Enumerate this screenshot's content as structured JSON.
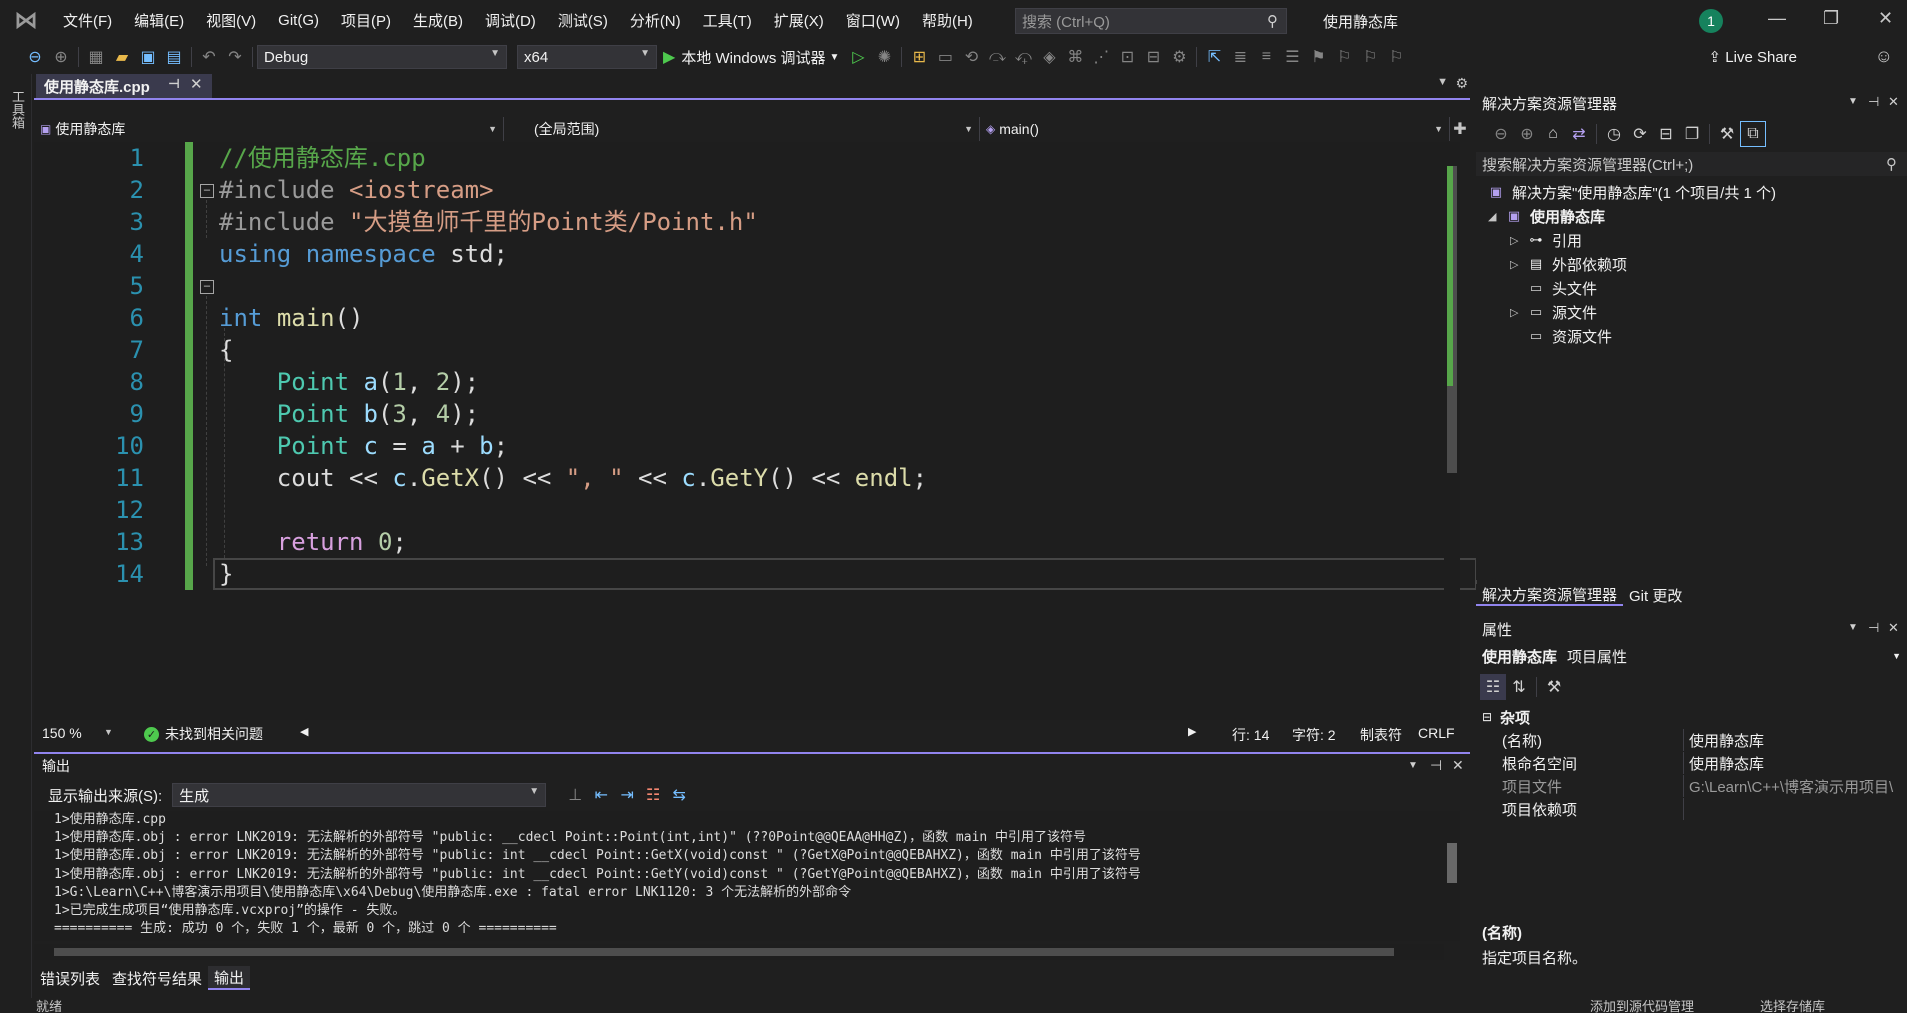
{
  "menubar": {
    "items": [
      "文件(F)",
      "编辑(E)",
      "视图(V)",
      "Git(G)",
      "项目(P)",
      "生成(B)",
      "调试(D)",
      "测试(S)",
      "分析(N)",
      "工具(T)",
      "扩展(X)",
      "窗口(W)",
      "帮助(H)"
    ],
    "search_placeholder": "搜索 (Ctrl+Q)",
    "window_title": "使用静态库",
    "notification_count": "1"
  },
  "toolbar": {
    "config": "Debug",
    "platform": "x64",
    "run_label": "本地 Windows 调试器",
    "live_share": "Live Share"
  },
  "left_strip": {
    "toolbox_label": "工具箱"
  },
  "editor": {
    "tab_label": "使用静态库.cpp",
    "nav_project": "使用静态库",
    "nav_scope": "(全局范围)",
    "nav_member": "main()",
    "line_numbers": [
      "1",
      "2",
      "3",
      "4",
      "5",
      "6",
      "7",
      "8",
      "9",
      "10",
      "11",
      "12",
      "13",
      "14"
    ],
    "code": {
      "l1": "//使用静态库.cpp",
      "l2_pp": "#include ",
      "l2_inc": "<iostream>",
      "l3_pp": "#include ",
      "l3_str": "\"大摸鱼师千里的Point类/Point.h\"",
      "l4_kw1": "using",
      "l4_kw2": "namespace",
      "l4_rest": " std;",
      "l6_kw": "int",
      "l6_fn": "main",
      "l6_rest": "()",
      "l7": "{",
      "l8_ty": "Point",
      "l8_var": "a",
      "l8_a1": "1",
      "l8_a2": "2",
      "l9_ty": "Point",
      "l9_var": "b",
      "l9_a1": "3",
      "l9_a2": "4",
      "l10_ty": "Point",
      "l10_var": "c",
      "l10_op1": "a",
      "l10_op2": "b",
      "l11_cout": "cout",
      "l11_obj1": "c",
      "l11_fn1": "GetX",
      "l11_str": "\", \"",
      "l11_obj2": "c",
      "l11_fn2": "GetY",
      "l11_endl": "endl",
      "l13_kw": "return",
      "l13_num": "0",
      "l14": "}"
    },
    "zoom": "150 %",
    "issues": "未找到相关问题",
    "line": "行: 14",
    "char": "字符: 2",
    "tabs_mode": "制表符",
    "eol": "CRLF"
  },
  "output": {
    "title": "输出",
    "source_label": "显示输出来源(S):",
    "source_value": "生成",
    "lines": [
      "1>使用静态库.cpp",
      "1>使用静态库.obj : error LNK2019: 无法解析的外部符号 \"public: __cdecl Point::Point(int,int)\" (??0Point@@QEAA@HH@Z)，函数 main 中引用了该符号",
      "1>使用静态库.obj : error LNK2019: 无法解析的外部符号 \"public: int __cdecl Point::GetX(void)const \" (?GetX@Point@@QEBAHXZ)，函数 main 中引用了该符号",
      "1>使用静态库.obj : error LNK2019: 无法解析的外部符号 \"public: int __cdecl Point::GetY(void)const \" (?GetY@Point@@QEBAHXZ)，函数 main 中引用了该符号",
      "1>G:\\Learn\\C++\\博客演示用项目\\使用静态库\\x64\\Debug\\使用静态库.exe : fatal error LNK1120: 3 个无法解析的外部命令",
      "1>已完成生成项目“使用静态库.vcxproj”的操作 - 失败。",
      "========== 生成: 成功 0 个，失败 1 个，最新 0 个，跳过 0 个 =========="
    ]
  },
  "bottom_tabs": [
    "错误列表",
    "查找符号结果",
    "输出"
  ],
  "statusbar": {
    "left": "就绪",
    "add_source": "添加到源代码管理",
    "select_repo": "选择存储库"
  },
  "solution": {
    "title": "解决方案资源管理器",
    "search_placeholder": "搜索解决方案资源管理器(Ctrl+;)",
    "solution_label": "解决方案\"使用静态库\"(1 个项目/共 1 个)",
    "project": "使用静态库",
    "nodes": [
      "引用",
      "外部依赖项",
      "头文件",
      "源文件",
      "资源文件"
    ],
    "tabs": [
      "解决方案资源管理器",
      "Git 更改"
    ]
  },
  "properties": {
    "title": "属性",
    "object_name": "使用静态库",
    "object_type": "项目属性",
    "category": "杂项",
    "rows": [
      {
        "name": "(名称)",
        "value": "使用静态库"
      },
      {
        "name": "根命名空间",
        "value": "使用静态库"
      },
      {
        "name": "项目文件",
        "value": "G:\\Learn\\C++\\博客演示用项目\\"
      },
      {
        "name": "项目依赖项",
        "value": ""
      }
    ],
    "desc_title": "(名称)",
    "desc_text": "指定项目名称。"
  },
  "colors": {
    "accent": "#9184ee",
    "change_bar": "#57a64a",
    "editor_bg": "#1e1e1e",
    "chrome_bg": "#1f1f1f"
  }
}
